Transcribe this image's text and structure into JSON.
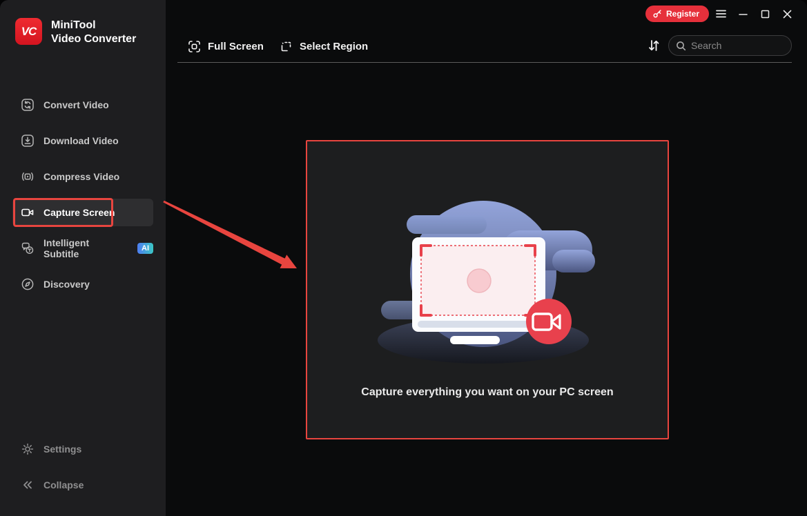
{
  "app": {
    "logo_text": "VC",
    "brand_line1": "MiniTool",
    "brand_line2": "Video Converter"
  },
  "titlebar": {
    "register_label": "Register",
    "controls": {
      "menu": "menu",
      "minimize": "minimize",
      "maximize": "maximize",
      "close": "close"
    }
  },
  "sidebar": {
    "items": [
      {
        "label": "Convert Video",
        "icon": "convert-icon"
      },
      {
        "label": "Download Video",
        "icon": "download-icon"
      },
      {
        "label": "Compress Video",
        "icon": "compress-icon"
      },
      {
        "label": "Capture Screen",
        "icon": "capture-icon",
        "selected": true
      },
      {
        "label": "Intelligent Subtitle",
        "icon": "subtitle-icon",
        "badge": "AI"
      },
      {
        "label": "Discovery",
        "icon": "discovery-icon"
      }
    ],
    "footer_items": [
      {
        "label": "Settings",
        "icon": "gear-icon"
      },
      {
        "label": "Collapse",
        "icon": "collapse-icon"
      }
    ]
  },
  "toolbar": {
    "full_screen_label": "Full Screen",
    "select_region_label": "Select Region",
    "search_placeholder": "Search"
  },
  "main": {
    "caption": "Capture everything you want on your PC screen"
  },
  "colors": {
    "accent_red": "#e8453f",
    "brand_red": "#e62129",
    "record_red": "#e8414d",
    "ai_badge_from": "#4e7df2",
    "ai_badge_to": "#3bc7c4",
    "blob_blue": "#8fa0d5",
    "panel_bg": "#1d1e1f",
    "sidebar_bg": "#1e1e20"
  }
}
